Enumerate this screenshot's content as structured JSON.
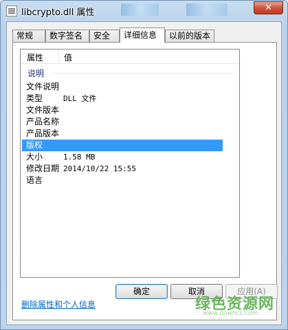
{
  "window": {
    "title": "libcrypto.dll 属性",
    "close_glyph": "✕"
  },
  "tabs": [
    {
      "label": "常规"
    },
    {
      "label": "数字签名"
    },
    {
      "label": "安全"
    },
    {
      "label": "详细信息",
      "active": true
    },
    {
      "label": "以前的版本"
    }
  ],
  "details": {
    "columns": {
      "property": "属性",
      "value": "值"
    },
    "group": "说明",
    "rows": [
      {
        "property": "文件说明",
        "value": ""
      },
      {
        "property": "类型",
        "value": "DLL 文件"
      },
      {
        "property": "文件版本",
        "value": ""
      },
      {
        "property": "产品名称",
        "value": ""
      },
      {
        "property": "产品版本",
        "value": ""
      },
      {
        "property": "版权",
        "value": "",
        "selected": true
      },
      {
        "property": "大小",
        "value": "1.58 MB"
      },
      {
        "property": "修改日期",
        "value": "2014/10/22 15:55"
      },
      {
        "property": "语言",
        "value": ""
      }
    ]
  },
  "remove_link": "删除属性和个人信息",
  "buttons": {
    "ok": "确定",
    "cancel": "取消",
    "apply": "应用(A)"
  },
  "watermark": {
    "text": "绿色资源网",
    "url": "www.downcc.com"
  },
  "colors": {
    "selection": "#3399ff",
    "link": "#0066cc",
    "close": "#c13a23"
  }
}
